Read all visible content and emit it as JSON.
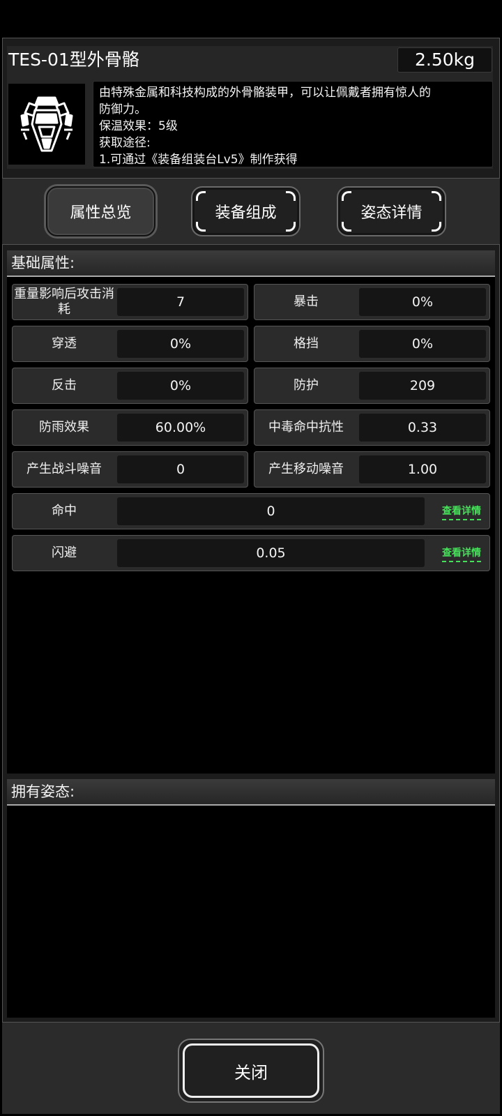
{
  "item": {
    "title": "TES-01型外骨骼",
    "weight": "2.50kg",
    "icon": "exoskeleton-armor-icon",
    "description": [
      "由特殊金属和科技构成的外骨骼装甲，可以让佩戴者拥有惊人的",
      "防御力。",
      "保温效果：5级",
      "获取途径:",
      "1.可通过《装备组装台Lv5》制作获得"
    ]
  },
  "tabs": [
    {
      "label": "属性总览",
      "active": true
    },
    {
      "label": "装备组成",
      "active": false
    },
    {
      "label": "姿态详情",
      "active": false
    }
  ],
  "sections": {
    "basic": "基础属性:",
    "stances": "拥有姿态:"
  },
  "stats": [
    {
      "label": "重量影响后攻击消耗",
      "value": "7"
    },
    {
      "label": "暴击",
      "value": "0%"
    },
    {
      "label": "穿透",
      "value": "0%"
    },
    {
      "label": "格挡",
      "value": "0%"
    },
    {
      "label": "反击",
      "value": "0%"
    },
    {
      "label": "防护",
      "value": "209"
    },
    {
      "label": "防雨效果",
      "value": "60.00%"
    },
    {
      "label": "中毒命中抗性",
      "value": "0.33"
    },
    {
      "label": "产生战斗噪音",
      "value": "0"
    },
    {
      "label": "产生移动噪音",
      "value": "1.00"
    }
  ],
  "wide_stats": [
    {
      "label": "命中",
      "value": "0",
      "link": "查看详情"
    },
    {
      "label": "闪避",
      "value": "0.05",
      "link": "查看详情"
    }
  ],
  "close_label": "关闭",
  "colors": {
    "link": "#47e05a",
    "background": "#000000",
    "panel": "#2b2b2b"
  }
}
